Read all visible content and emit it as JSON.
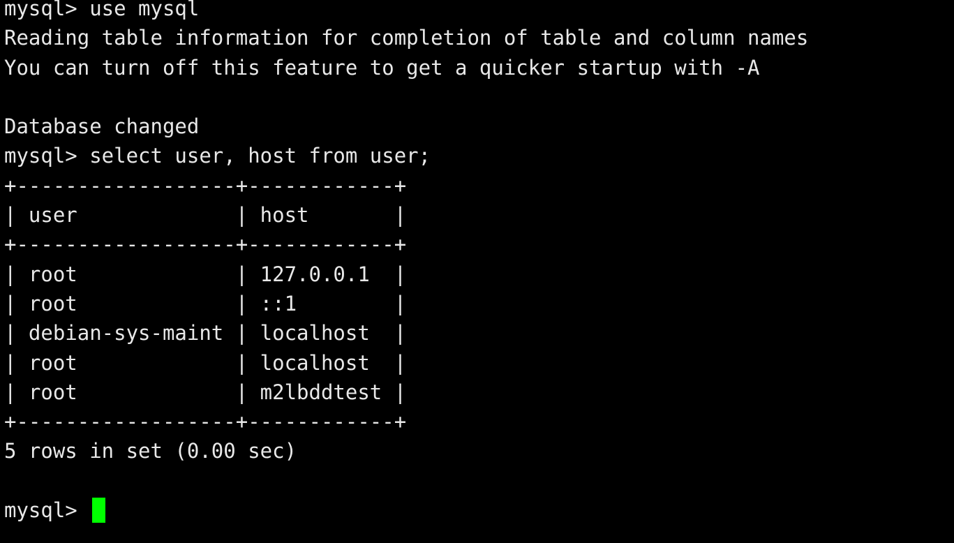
{
  "terminal": {
    "lines": [
      "mysql> use mysql",
      "Reading table information for completion of table and column names",
      "You can turn off this feature to get a quicker startup with -A",
      "",
      "Database changed",
      "mysql> select user, host from user;",
      "+------------------+------------+",
      "| user             | host       |",
      "+------------------+------------+",
      "| root             | 127.0.0.1  |",
      "| root             | ::1        |",
      "| debian-sys-maint | localhost  |",
      "| root             | localhost  |",
      "| root             | m2lbddtest |",
      "+------------------+------------+",
      "5 rows in set (0.00 sec)",
      ""
    ],
    "prompt": "mysql> ",
    "cursor_color": "#00ff00",
    "background_color": "#000000",
    "text_color": "#e8e8e8"
  }
}
